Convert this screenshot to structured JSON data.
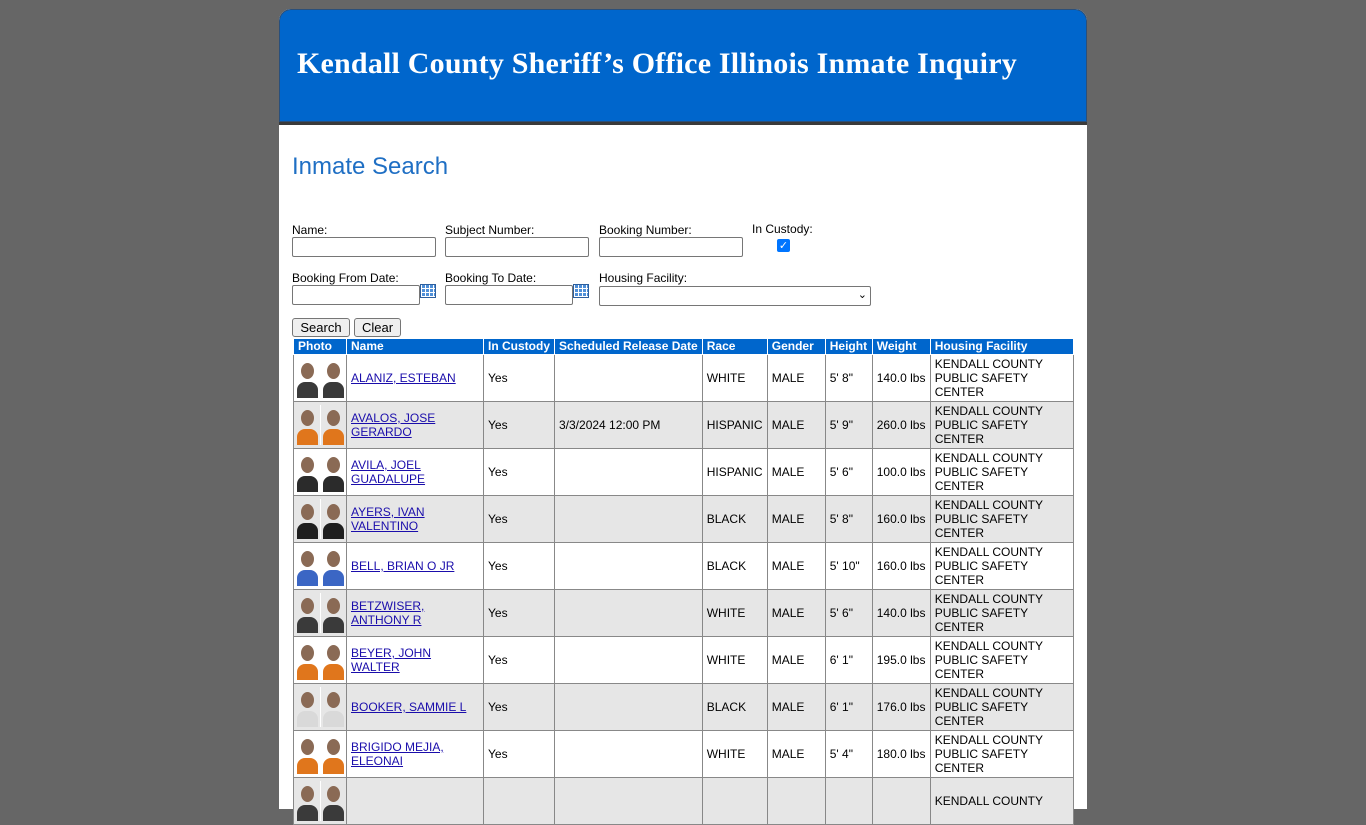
{
  "header": {
    "title": "Kendall County Sheriff’s Office Illinois Inmate Inquiry"
  },
  "search": {
    "heading": "Inmate Search",
    "name_label": "Name:",
    "name_value": "",
    "subject_label": "Subject Number:",
    "subject_value": "",
    "booking_label": "Booking Number:",
    "booking_value": "",
    "custody_label": "In Custody:",
    "custody_checked": true,
    "from_label": "Booking From Date:",
    "from_value": "",
    "to_label": "Booking To Date:",
    "to_value": "",
    "facility_label": "Housing Facility:",
    "facility_value": "",
    "search_button": "Search",
    "clear_button": "Clear"
  },
  "table": {
    "headers": [
      "Photo",
      "Name",
      "In Custody",
      "Scheduled Release Date",
      "Race",
      "Gender",
      "Height",
      "Weight",
      "Housing Facility"
    ],
    "rows": [
      {
        "name": "ALANIZ, ESTEBAN",
        "custody": "Yes",
        "release": "",
        "race": "WHITE",
        "gender": "MALE",
        "height": "5' 8\"",
        "weight": "140.0 lbs",
        "facility": "KENDALL COUNTY PUBLIC SAFETY CENTER",
        "shirt": "#3a3a3a"
      },
      {
        "name": "AVALOS, JOSE GERARDO",
        "custody": "Yes",
        "release": "3/3/2024 12:00 PM",
        "race": "HISPANIC",
        "gender": "MALE",
        "height": "5' 9\"",
        "weight": "260.0 lbs",
        "facility": "KENDALL COUNTY PUBLIC SAFETY CENTER",
        "shirt": "#e0761c"
      },
      {
        "name": "AVILA, JOEL GUADALUPE",
        "custody": "Yes",
        "release": "",
        "race": "HISPANIC",
        "gender": "MALE",
        "height": "5' 6\"",
        "weight": "100.0 lbs",
        "facility": "KENDALL COUNTY PUBLIC SAFETY CENTER",
        "shirt": "#2b2b2b"
      },
      {
        "name": "AYERS, IVAN VALENTINO",
        "custody": "Yes",
        "release": "",
        "race": "BLACK",
        "gender": "MALE",
        "height": "5' 8\"",
        "weight": "160.0 lbs",
        "facility": "KENDALL COUNTY PUBLIC SAFETY CENTER",
        "shirt": "#1f1f1f"
      },
      {
        "name": "BELL, BRIAN O JR",
        "custody": "Yes",
        "release": "",
        "race": "BLACK",
        "gender": "MALE",
        "height": "5' 10\"",
        "weight": "160.0 lbs",
        "facility": "KENDALL COUNTY PUBLIC SAFETY CENTER",
        "shirt": "#3b66c4"
      },
      {
        "name": "BETZWISER, ANTHONY R",
        "custody": "Yes",
        "release": "",
        "race": "WHITE",
        "gender": "MALE",
        "height": "5' 6\"",
        "weight": "140.0 lbs",
        "facility": "KENDALL COUNTY PUBLIC SAFETY CENTER",
        "shirt": "#3a3a3a"
      },
      {
        "name": "BEYER, JOHN WALTER",
        "custody": "Yes",
        "release": "",
        "race": "WHITE",
        "gender": "MALE",
        "height": "6' 1\"",
        "weight": "195.0 lbs",
        "facility": "KENDALL COUNTY PUBLIC SAFETY CENTER",
        "shirt": "#e0761c"
      },
      {
        "name": "BOOKER, SAMMIE L",
        "custody": "Yes",
        "release": "",
        "race": "BLACK",
        "gender": "MALE",
        "height": "6' 1\"",
        "weight": "176.0 lbs",
        "facility": "KENDALL COUNTY PUBLIC SAFETY CENTER",
        "shirt": "#d9d9d9"
      },
      {
        "name": "BRIGIDO MEJIA, ELEONAI",
        "custody": "Yes",
        "release": "",
        "race": "WHITE",
        "gender": "MALE",
        "height": "5' 4\"",
        "weight": "180.0 lbs",
        "facility": "KENDALL COUNTY PUBLIC SAFETY CENTER",
        "shirt": "#e0761c"
      },
      {
        "name": "",
        "custody": "",
        "release": "",
        "race": "",
        "gender": "",
        "height": "",
        "weight": "",
        "facility": "KENDALL COUNTY",
        "shirt": "#3a3a3a"
      }
    ]
  }
}
